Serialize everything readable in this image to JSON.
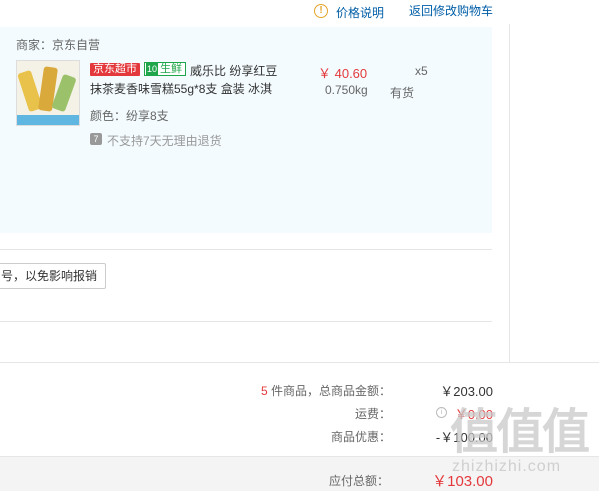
{
  "header": {
    "price_note_label": "价格说明",
    "back_to_cart_label": "返回修改购物车",
    "info_icon_glyph": "!"
  },
  "order": {
    "merchant_label": "商家：京东自营",
    "item": {
      "tag_jd": "京东超市",
      "tag_fresh": "生鲜",
      "tag_fresh_icon": "10",
      "title_line1": "威乐比 纷享红豆",
      "title_line2": "抹茶麦香味雪糕55g*8支 盒装 冰淇",
      "price": "￥ 40.60",
      "weight": "0.750kg",
      "quantity": "x5",
      "stock": "有货",
      "color_spec": "颜色：纷享8支",
      "return_policy": "不支持7天无理由退货",
      "return_icon_glyph": "7"
    },
    "invoice_note": "号，以免影响报销"
  },
  "summary": {
    "items_count": "5",
    "items_label": " 件商品，总商品金额：",
    "items_total": "￥203.00",
    "shipping_label": "运费：",
    "shipping_value": "￥0.00",
    "discount_label": "商品优惠：",
    "discount_value": "-￥100.00",
    "total_label": "应付总额：",
    "total_value": "￥103.00"
  },
  "watermark": {
    "main": "值值值",
    "sub": "zhizhizhi.com"
  },
  "colors": {
    "accent_red": "#e4393c",
    "link_blue": "#005ea7",
    "fresh_green": "#1fa54a",
    "block_bg": "#f3fbfe"
  }
}
